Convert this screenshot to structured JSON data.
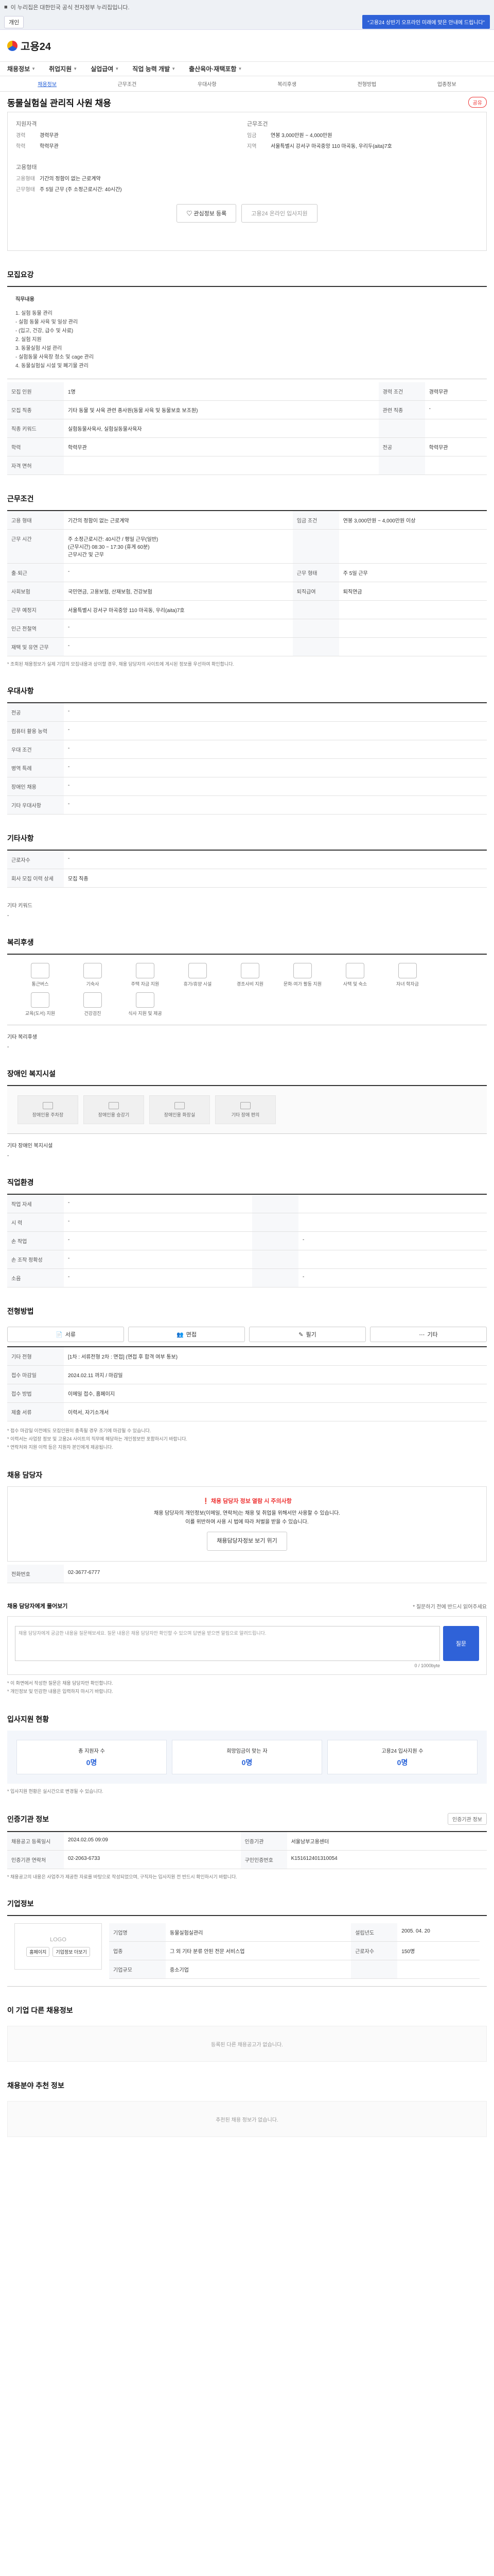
{
  "topbar": {
    "text": "이 누리집은 대한민국 공식 전자정부 누리집입니다."
  },
  "bluebar": {
    "tag": "개인",
    "notice": "“고용24 상반기 오프라인 미래에 맞은 안내에 드립니다”"
  },
  "header": {
    "logo": "고용24"
  },
  "gnb": [
    "채용정보",
    "취업지원",
    "실업급여",
    "직업 능력 개발",
    "출산육아·재택포함"
  ],
  "subnav": [
    "채용정보",
    "근무조건",
    "우대사항",
    "복리후생",
    "전형방법",
    "업종정보"
  ],
  "job": {
    "title": "동물실험실 관리직 사원 채용",
    "share": "공유"
  },
  "company": {
    "label": "지원자격",
    "left": [
      {
        "k": "경력",
        "v": "경력무관"
      },
      {
        "k": "학력",
        "v": "학력무관"
      }
    ],
    "cond_label": "근무조건",
    "right": [
      {
        "k": "임금",
        "v": "연봉 3,000만원 ~ 4,000만원"
      },
      {
        "k": "지역",
        "v": "서울특별시 강서구 마곡중앙 110 마곡동, 우리두(aita)7호"
      }
    ],
    "type_label": "고용형태",
    "type": [
      {
        "k": "고용형태",
        "v": "기간의 정함이 없는 근로계약"
      },
      {
        "k": "근무형태",
        "v": "주 5일 근무 (주 소정근로시간: 40시간)"
      }
    ]
  },
  "buttons": {
    "interest": "관심정보 등록",
    "apply": "고용24 온라인 입사지원"
  },
  "sections": {
    "duty": "모집요강",
    "duty_box_label": "직무내용",
    "duty_text": "1. 실험 동물 관리\n - 실험 동물 사육 및 일상 관리\n - (입고, 건강, 급수 및 사료)\n2. 실험 지원\n3. 동물실험 시설 관리\n - 실험동물 사육장 청소 및 cage 관리\n4. 동물실험실 시설 및 폐기물 관리",
    "recruit_rows": [
      [
        "모집 인원",
        "1명",
        "경력 조건",
        "경력무관"
      ],
      [
        "모집 직종",
        "기타 동물 및 사육 관련 종사원(동물 사육 및 동물보호 보조원)",
        "관련 직종",
        "-"
      ],
      [
        "직종 키워드",
        "실험동물사육사, 실험실동물사육자",
        "",
        ""
      ],
      [
        "학력",
        "학력무관",
        "전공",
        "학력무관"
      ],
      [
        "자격 면허",
        "",
        "",
        ""
      ]
    ],
    "cond": "근무조건",
    "work_rows": [
      [
        "고용 형태",
        "기간의 정함이 없는 근로계약",
        "임금 조건",
        "연봉 3,000만원 ~ 4,000만원 이상"
      ],
      [
        "근무 시간",
        "주 소정근로시간: 40시간 / 평일 근무(일반)\n(근무시간) 08:30 ~ 17:30 (휴게 60분)\n근무시간 및 근무",
        "",
        ""
      ],
      [
        "출·퇴근",
        "-",
        "근무 형태",
        "주 5일 근무"
      ],
      [
        "사회보험",
        "국민연금, 고용보험, 산재보험, 건강보험",
        "퇴직급여",
        "퇴직연금"
      ],
      [
        "근무 예정지",
        "서울특별시 강서구 마곡중앙 110 마곡동, 우리(aita)7호",
        "",
        ""
      ],
      [
        "인근 전철역",
        "-",
        "",
        ""
      ],
      [
        "재택 및 유연 근무",
        "-",
        "",
        ""
      ]
    ],
    "cond_note": "* 조회된 채용정보가 실제 기업의 모집내용과 상이할 경우, 채용 담당자의 사이트에 게시된 정보를 우선하여 확인합니다.",
    "pref": "우대사항",
    "pref_rows": [
      [
        "전공",
        "-"
      ],
      [
        "컴퓨터 활용 능력",
        "-"
      ],
      [
        "우대 조건",
        "-"
      ],
      [
        "병역 특례",
        "-"
      ],
      [
        "장애인 채용",
        "-"
      ],
      [
        "기타 우대사항",
        "-"
      ]
    ],
    "other": "기타사항",
    "other_rows": [
      [
        "근로자수",
        "-"
      ],
      [
        "회사 모집 이력 상세",
        "모집 직종"
      ]
    ],
    "keyword": "기타 키워드",
    "keyword_val": "-",
    "welfare": "복리후생",
    "welfare_icons": [
      "통근버스",
      "기숙사",
      "주택 자금 지원",
      "휴가/휴양 시설",
      "경조사비 지원",
      "문화·여가 활동 지원",
      "사택 및 숙소",
      "자녀 학자금",
      "교육(도서) 지원",
      "건강검진",
      "식사 지원 및 제공"
    ],
    "welfare_label": "기타 복리후생",
    "welfare_val": "-",
    "dis": "장애인 복지시설",
    "dis_icons": [
      "장애인용 주차장",
      "장애인용 승강기",
      "장애인용 화장실",
      "기타 장애 편의"
    ],
    "dis_label": "기타 장애인 복지시설",
    "dis_val": "-",
    "biz": "직업환경",
    "biz_rows": [
      [
        "작업 자세",
        "-",
        "",
        ""
      ],
      [
        "시 력",
        "-",
        "",
        ""
      ],
      [
        "손 작업",
        "-",
        "",
        "-"
      ],
      [
        "손 조작 정확성",
        "-",
        "",
        ""
      ],
      [
        "소음",
        "-",
        "",
        "-"
      ]
    ],
    "method": "전형방법",
    "method_btns": [
      "서류",
      "면접",
      "필기",
      "기타"
    ],
    "method_rows": [
      [
        "기타 전형",
        "[1차 : 서류전형 2차 : 면접] (면접 후 합격 여부 통보)"
      ],
      [
        "접수 마감일",
        "2024.02.11 까지 / 마감일"
      ],
      [
        "접수 방법",
        "이메일 접수, 홈페이지"
      ],
      [
        "제출 서류",
        "이력서, 자기소개서"
      ]
    ],
    "method_notes": [
      "* 접수 마감일 이전에도 모집인원이 충족될 경우 조기에 마감될 수 있습니다.",
      "* 이력서는 사업장 정보 및 고용24 사이트의 직무에 해당하는 개인정보만 포함하시기 바랍니다.",
      "* 연락처와 지원 이력 등은 지원자 본인에게 제공됩니다."
    ],
    "contact": "채용 담당자",
    "contact_alert": "채용 담당자 정보 열람 시 주의사항",
    "contact_text": "채용 담당자의 개인정보(이메일, 연락처)는 채용 및 취업을 위해서만 사용할 수 있습니다.\n이를 위반하여 사용 시 법에 따라 처벌을 받을 수 있습니다.",
    "contact_btn": "채용담당자정보 보기 위기",
    "contact_row": [
      "전화번호",
      "02-3677-6777"
    ],
    "qa": "채용 담당자에게 물어보기",
    "qa_note": "* 질문하기 전에 반드시 읽어주세요",
    "qa_placeholder": "채용 담당자에게 궁금한 내용을 질문해보세요. 질문 내용은 채용 담당자만 확인할 수 있으며 답변을 받으면 알림으로 알려드립니다.",
    "qa_count": "0 / 1000byte",
    "qa_btn": "질문",
    "qa_bullets": [
      "* 이 화면에서 작성한 질문은 채용 담당자만 확인합니다.",
      "* 개인정보 및 민감한 내용은 입력하지 마시기 바랍니다."
    ],
    "apply": "입사지원 현황",
    "stats": [
      {
        "label": "총 지원자 수",
        "val": "0명"
      },
      {
        "label": "희망임금이 맞는 자",
        "val": "0명"
      },
      {
        "label": "고용24 입사지원 수",
        "val": "0명"
      }
    ],
    "apply_note": "* 입사지원 현황은 실시간으로 변경될 수 있습니다.",
    "summary": "인증기관 정보",
    "summary_btn": "인증기관 정보",
    "summary_rows": [
      [
        "채용공고 등록일시",
        "2024.02.05 09:09",
        "인증기관",
        "서울남부고용센터"
      ],
      [
        "인증기관 연락처",
        "02-2063-6733",
        "구인인증번호",
        "K151612401310054"
      ]
    ],
    "summary_note": "* 채용공고의 내용은 사업주가 제공한 자료를 바탕으로 작성되었으며, 구직자는 입사지원 전 반드시 확인하시기 바랍니다.",
    "corp": "기업정보",
    "corp_logo": "LOGO",
    "corp_rows": [
      [
        "기업명",
        "동물실험실관리",
        "설립년도",
        "2005. 04. 20"
      ],
      [
        "업종",
        "그 외 기타 분류 안된 전문 서비스업",
        "근로자수",
        "150명"
      ],
      [
        "기업규모",
        "중소기업",
        "",
        ""
      ]
    ],
    "corp_links": [
      "홈페이지",
      "기업정보 더보기"
    ],
    "same_company": "이 기업 다른 채용정보",
    "same_empty": "등록된 다른 채용공고가 없습니다.",
    "rec": "채용분야 추천 정보",
    "rec_empty": "추천된 채용 정보가 없습니다."
  }
}
